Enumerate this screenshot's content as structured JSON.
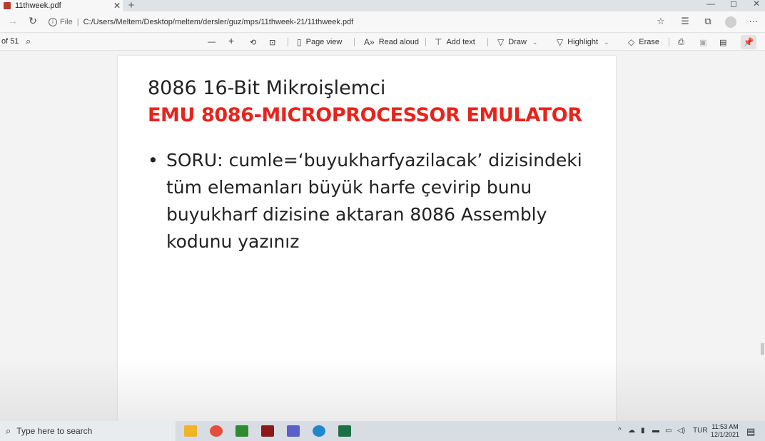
{
  "browser": {
    "tab_title": "11thweek.pdf",
    "tab_close": "✕",
    "new_tab": "+",
    "url_scheme": "File",
    "url_separator": "|",
    "url_path": "C:/Users/Meltem/Desktop/meltem/dersler/guz/mps/11thweek-21/11thweek.pdf",
    "window_controls": [
      "—",
      "◻",
      "✕"
    ],
    "more": "···"
  },
  "pdf_toolbar": {
    "page_info": "of 51",
    "zoom_out": "—",
    "zoom_in": "+",
    "page_view": "Page view",
    "read_aloud": "Read aloud",
    "add_text": "Add text",
    "draw": "Draw",
    "highlight": "Highlight",
    "erase": "Erase"
  },
  "slide": {
    "title": "8086 16-Bit Mikroişlemci",
    "subtitle": "EMU 8086-MICROPROCESSOR EMULATOR",
    "bullet_marker": "•",
    "bullet_text": "SORU: cumle=‘buyukharfyazilacak’ dizisindeki tüm elemanları büyük harfe çevirip bunu buyukharf dizisine aktaran 8086 Assembly kodunu yazınız"
  },
  "taskbar": {
    "search_placeholder": "Type here to search",
    "language": "TUR",
    "time": "11:53 AM",
    "date": "12/1/2021"
  },
  "colors": {
    "subtitle_red": "#e8231c",
    "taskbar": "#d8dde3",
    "toolbar": "#f7f7f7"
  }
}
